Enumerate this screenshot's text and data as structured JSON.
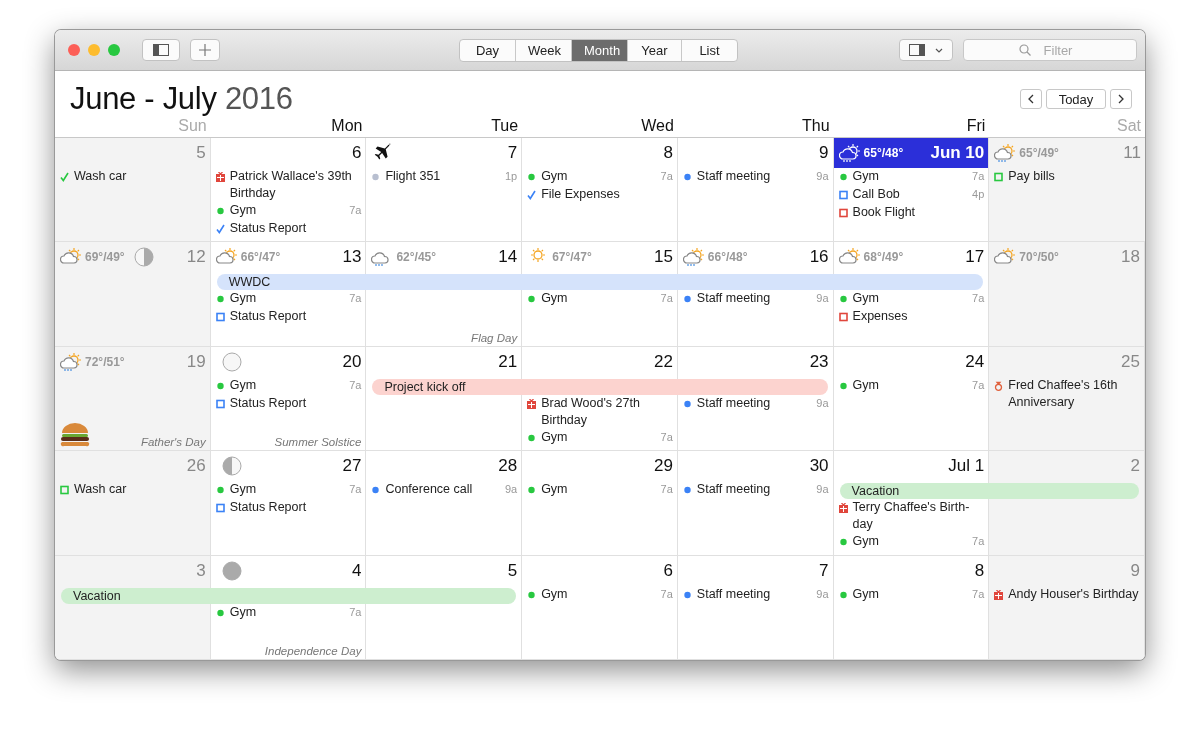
{
  "toolbar": {
    "views": [
      {
        "label": "Day",
        "selected": false
      },
      {
        "label": "Week",
        "selected": false
      },
      {
        "label": "Month",
        "selected": true
      },
      {
        "label": "Year",
        "selected": false
      },
      {
        "label": "List",
        "selected": false
      }
    ],
    "search": {
      "placeholder": "Filter"
    }
  },
  "header": {
    "title": "June - July",
    "year": "2016",
    "today_button": "Today"
  },
  "weekdays": [
    {
      "label": "Sun",
      "weekend": true
    },
    {
      "label": "Mon",
      "weekend": false
    },
    {
      "label": "Tue",
      "weekend": false
    },
    {
      "label": "Wed",
      "weekend": false
    },
    {
      "label": "Thu",
      "weekend": false
    },
    {
      "label": "Fri",
      "weekend": false
    },
    {
      "label": "Sat",
      "weekend": true
    }
  ],
  "weeks": [
    {
      "days": [
        {
          "day": "5",
          "weekend": true,
          "today": false,
          "events": [
            {
              "kind": "check",
              "color": "#28c840",
              "title": "Wash car"
            }
          ]
        },
        {
          "day": "6",
          "weekend": false,
          "today": false,
          "events": [
            {
              "kind": "gift",
              "color": "#e0463c",
              "title": "Patrick Wallace's 39th Birthday"
            },
            {
              "kind": "dot",
              "color": "#28c840",
              "title": "Gym",
              "time": "7a"
            },
            {
              "kind": "check",
              "color": "#3b82f6",
              "title": "Status Report"
            }
          ]
        },
        {
          "day": "7",
          "weekend": false,
          "today": false,
          "icon": {
            "kind": "airplane"
          },
          "events": [
            {
              "kind": "dot",
              "color": "#b8bfd0",
              "title": "Flight 351",
              "time": "1p"
            }
          ]
        },
        {
          "day": "8",
          "weekend": false,
          "today": false,
          "events": [
            {
              "kind": "dot",
              "color": "#28c840",
              "title": "Gym",
              "time": "7a"
            },
            {
              "kind": "check",
              "color": "#3b82f6",
              "title": "File Expenses"
            }
          ]
        },
        {
          "day": "9",
          "weekend": false,
          "today": false,
          "events": [
            {
              "kind": "dot",
              "color": "#3b82f6",
              "title": "Staff meeting",
              "time": "9a"
            }
          ]
        },
        {
          "day": "Jun 10",
          "weekend": false,
          "today": true,
          "weather": {
            "kind": "rain-sun",
            "temps": "65°/48°"
          },
          "events": [
            {
              "kind": "dot",
              "color": "#28c840",
              "title": "Gym",
              "time": "7a"
            },
            {
              "kind": "square",
              "color": "#3b82f6",
              "title": "Call Bob",
              "time": "4p"
            },
            {
              "kind": "square",
              "color": "#e0463c",
              "title": "Book Flight"
            }
          ]
        },
        {
          "day": "11",
          "weekend": true,
          "today": false,
          "weather": {
            "kind": "rain-sun",
            "temps": "65°/49°"
          },
          "events": [
            {
              "kind": "square",
              "color": "#28c840",
              "title": "Pay bills"
            }
          ]
        }
      ]
    },
    {
      "days": [
        {
          "day": "12",
          "weekend": true,
          "today": false,
          "weather": {
            "kind": "partly-sunny",
            "temps": "69°/49°"
          },
          "moon": {
            "kind": "first-quarter"
          }
        },
        {
          "day": "13",
          "weekend": false,
          "today": false,
          "weather": {
            "kind": "partly-sunny",
            "temps": "66°/47°"
          },
          "bar": {
            "title": "WWDC",
            "color": "#d5e3fb"
          },
          "events": [
            {
              "kind": "dot",
              "color": "#28c840",
              "title": "Gym",
              "time": "7a"
            },
            {
              "kind": "square",
              "color": "#3b82f6",
              "title": "Status Report"
            }
          ]
        },
        {
          "day": "14",
          "weekend": false,
          "today": false,
          "weather": {
            "kind": "rain",
            "temps": "62°/45°"
          },
          "bar_continues": true,
          "holiday": "Flag Day"
        },
        {
          "day": "15",
          "weekend": false,
          "today": false,
          "weather": {
            "kind": "sunny",
            "temps": "67°/47°"
          },
          "bar_continues": true,
          "events": [
            {
              "kind": "dot",
              "color": "#28c840",
              "title": "Gym",
              "time": "7a"
            }
          ]
        },
        {
          "day": "16",
          "weekend": false,
          "today": false,
          "weather": {
            "kind": "rain-sun",
            "temps": "66°/48°"
          },
          "bar_continues": true,
          "events": [
            {
              "kind": "dot",
              "color": "#3b82f6",
              "title": "Staff meeting",
              "time": "9a"
            }
          ]
        },
        {
          "day": "17",
          "weekend": false,
          "today": false,
          "weather": {
            "kind": "partly-sunny",
            "temps": "68°/49°"
          },
          "bar_continues": true,
          "events": [
            {
              "kind": "dot",
              "color": "#28c840",
              "title": "Gym",
              "time": "7a"
            },
            {
              "kind": "square",
              "color": "#e0463c",
              "title": "Expenses"
            }
          ]
        },
        {
          "day": "18",
          "weekend": true,
          "today": false,
          "weather": {
            "kind": "partly-sunny",
            "temps": "70°/50°"
          }
        }
      ]
    },
    {
      "days": [
        {
          "day": "19",
          "weekend": true,
          "today": false,
          "weather": {
            "kind": "rain-sun",
            "temps": "72°/51°"
          },
          "holiday": "Father's Day",
          "drawing": {
            "kind": "burger"
          }
        },
        {
          "day": "20",
          "weekend": false,
          "today": false,
          "moon": {
            "kind": "new"
          },
          "holiday": "Summer Solstice",
          "events": [
            {
              "kind": "dot",
              "color": "#28c840",
              "title": "Gym",
              "time": "7a"
            },
            {
              "kind": "square",
              "color": "#3b82f6",
              "title": "Status Report"
            }
          ]
        },
        {
          "day": "21",
          "weekend": false,
          "today": false,
          "bar": {
            "title": "Project kick off",
            "color": "#fcd3cf"
          }
        },
        {
          "day": "22",
          "weekend": false,
          "today": false,
          "bar_continues": true,
          "events": [
            {
              "kind": "gift",
              "color": "#e0463c",
              "title": "Brad Wood's 27th Birthday"
            },
            {
              "kind": "dot",
              "color": "#28c840",
              "title": "Gym",
              "time": "7a"
            }
          ]
        },
        {
          "day": "23",
          "weekend": false,
          "today": false,
          "bar_continues": true,
          "events": [
            {
              "kind": "dot",
              "color": "#3b82f6",
              "title": "Staff meeting",
              "time": "9a"
            }
          ]
        },
        {
          "day": "24",
          "weekend": false,
          "today": false,
          "events": [
            {
              "kind": "dot",
              "color": "#28c840",
              "title": "Gym",
              "time": "7a"
            }
          ]
        },
        {
          "day": "25",
          "weekend": true,
          "today": false,
          "events": [
            {
              "kind": "ring",
              "color": "#e0603c",
              "title": "Fred Chaffee's 16th Anniversary"
            }
          ]
        }
      ]
    },
    {
      "days": [
        {
          "day": "26",
          "weekend": true,
          "today": false,
          "events": [
            {
              "kind": "square",
              "color": "#28c840",
              "title": "Wash car"
            }
          ]
        },
        {
          "day": "27",
          "weekend": false,
          "today": false,
          "moon": {
            "kind": "last-quarter"
          },
          "events": [
            {
              "kind": "dot",
              "color": "#28c840",
              "title": "Gym",
              "time": "7a"
            },
            {
              "kind": "square",
              "color": "#3b82f6",
              "title": "Status Report"
            }
          ]
        },
        {
          "day": "28",
          "weekend": false,
          "today": false,
          "events": [
            {
              "kind": "dot",
              "color": "#3b82f6",
              "title": "Conference call",
              "time": "9a"
            }
          ]
        },
        {
          "day": "29",
          "weekend": false,
          "today": false,
          "events": [
            {
              "kind": "dot",
              "color": "#28c840",
              "title": "Gym",
              "time": "7a"
            }
          ]
        },
        {
          "day": "30",
          "weekend": false,
          "today": false,
          "events": [
            {
              "kind": "dot",
              "color": "#3b82f6",
              "title": "Staff meeting",
              "time": "9a"
            }
          ]
        },
        {
          "day": "Jul 1",
          "weekend": false,
          "today": false,
          "bar": {
            "title": "Vacation",
            "color": "#cdeecf"
          },
          "events": [
            {
              "kind": "gift",
              "color": "#e0463c",
              "title": "Terry Chaffee's Birth-day"
            },
            {
              "kind": "dot",
              "color": "#28c840",
              "title": "Gym",
              "time": "7a"
            }
          ]
        },
        {
          "day": "2",
          "weekend": true,
          "today": false,
          "bar_continues": true
        }
      ]
    },
    {
      "days": [
        {
          "day": "3",
          "weekend": true,
          "today": false,
          "bar": {
            "title": "Vacation",
            "color": "#cdeecf"
          }
        },
        {
          "day": "4",
          "weekend": false,
          "today": false,
          "bar_continues": true,
          "moon": {
            "kind": "full"
          },
          "holiday": "Independence Day",
          "events": [
            {
              "kind": "dot",
              "color": "#28c840",
              "title": "Gym",
              "time": "7a"
            }
          ]
        },
        {
          "day": "5",
          "weekend": false,
          "today": false,
          "bar_continues": true
        },
        {
          "day": "6",
          "weekend": false,
          "today": false,
          "events": [
            {
              "kind": "dot",
              "color": "#28c840",
              "title": "Gym",
              "time": "7a"
            }
          ]
        },
        {
          "day": "7",
          "weekend": false,
          "today": false,
          "events": [
            {
              "kind": "dot",
              "color": "#3b82f6",
              "title": "Staff meeting",
              "time": "9a"
            }
          ]
        },
        {
          "day": "8",
          "weekend": false,
          "today": false,
          "events": [
            {
              "kind": "dot",
              "color": "#28c840",
              "title": "Gym",
              "time": "7a"
            }
          ]
        },
        {
          "day": "9",
          "weekend": true,
          "today": false,
          "events": [
            {
              "kind": "gift",
              "color": "#e0463c",
              "title": "Andy Houser's Birthday"
            }
          ]
        }
      ]
    }
  ]
}
